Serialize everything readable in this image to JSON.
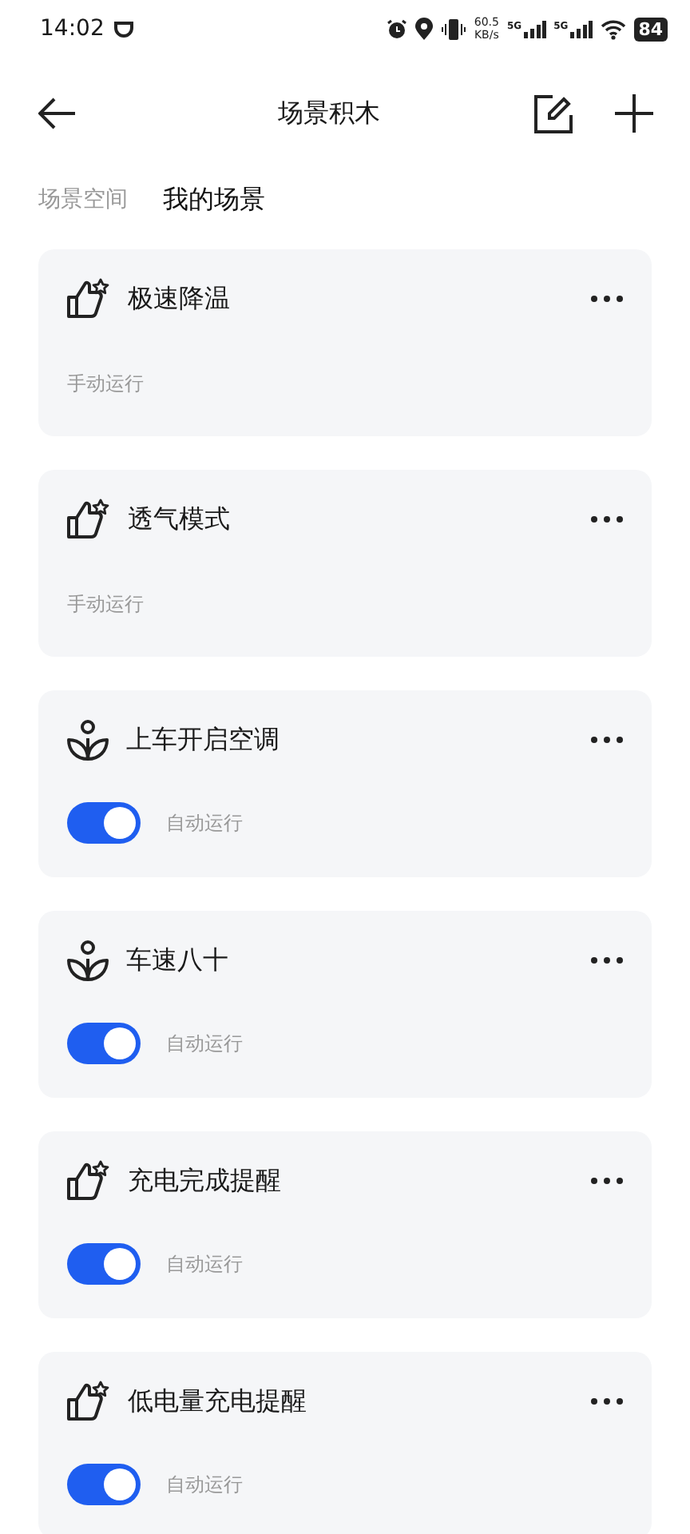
{
  "status_bar": {
    "time": "14:02",
    "net_speed": "60.5",
    "net_unit": "KB/s",
    "sim1": "5G",
    "sim2": "5G",
    "battery": "84"
  },
  "header": {
    "title": "场景积木"
  },
  "tabs": [
    {
      "label": "场景空间",
      "selected": false
    },
    {
      "label": "我的场景",
      "selected": true
    }
  ],
  "scenes": [
    {
      "title": "极速降温",
      "kind": "manual",
      "mode": "手动运行"
    },
    {
      "title": "透气模式",
      "kind": "manual",
      "mode": "手动运行"
    },
    {
      "title": "上车开启空调",
      "kind": "auto",
      "on": true,
      "mode": "自动运行"
    },
    {
      "title": "车速八十",
      "kind": "auto",
      "on": true,
      "mode": "自动运行"
    },
    {
      "title": "充电完成提醒",
      "kind": "auto",
      "on": true,
      "mode": "自动运行"
    },
    {
      "title": "低电量充电提醒",
      "kind": "auto",
      "on": true,
      "mode": "自动运行"
    }
  ]
}
